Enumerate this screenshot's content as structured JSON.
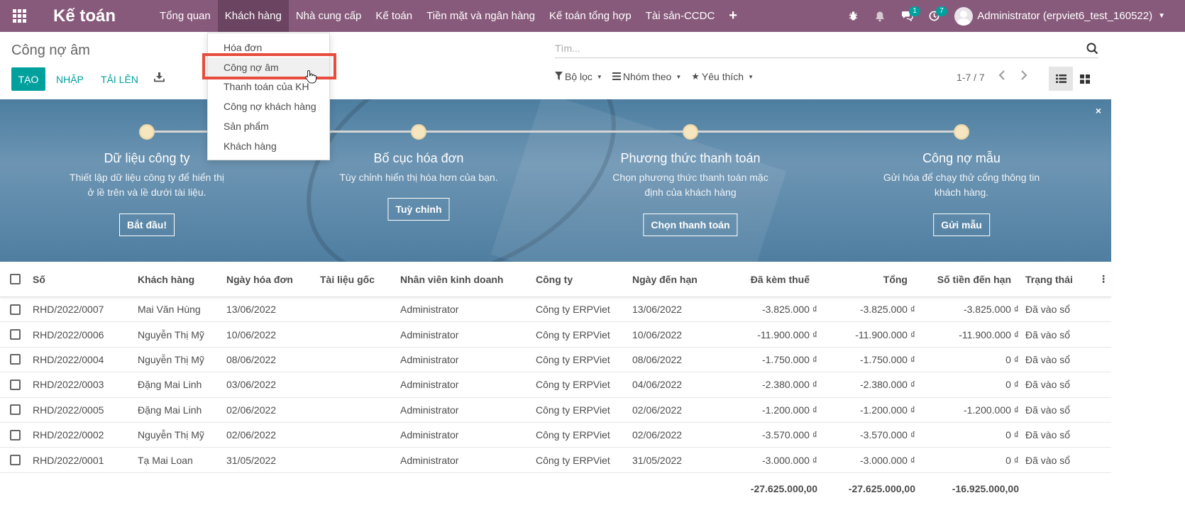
{
  "navbar": {
    "brand": "Kế toán",
    "menu": [
      "Tổng quan",
      "Khách hàng",
      "Nhà cung cấp",
      "Kế toán",
      "Tiền mặt và ngân hàng",
      "Kế toán tổng hợp",
      "Tài sản-CCDC"
    ],
    "active_menu": "Khách hàng",
    "plus": "+",
    "messages_count": "1",
    "activities_count": "7",
    "user": "Administrator (erpviet6_test_160522)"
  },
  "control": {
    "breadcrumb": "Công nợ âm",
    "search_placeholder": "Tìm...",
    "create_label": "TẠO",
    "import_label": "NHẬP",
    "upload_label": "TẢI LÊN",
    "filter_label": "Bộ lọc",
    "groupby_label": "Nhóm theo",
    "favorites_label": "Yêu thích",
    "pager": "1-7 / 7"
  },
  "dropdown": {
    "items": [
      "Hóa đơn",
      "Công nợ âm",
      "Thanh toán của KH",
      "Công nợ khách hàng",
      "Sản phẩm",
      "Khách hàng"
    ],
    "highlighted": "Công nợ âm"
  },
  "banner": {
    "close": "×",
    "steps": [
      {
        "title": "Dữ liệu công ty",
        "desc1": "Thiết lập dữ liệu công ty để hiển thị",
        "desc2": "ở lề trên và lề dưới tài liệu.",
        "button": "Bắt đầu!"
      },
      {
        "title": "Bố cục hóa đơn",
        "desc1": "Tùy chỉnh hiển thị hóa hơn của bạn.",
        "desc2": "",
        "button": "Tuỳ chỉnh"
      },
      {
        "title": "Phương thức thanh toán",
        "desc1": "Chọn phương thức thanh toán mặc",
        "desc2": "định của khách hàng",
        "button": "Chọn thanh toán"
      },
      {
        "title": "Công nợ mẫu",
        "desc1": "Gửi hóa để chạy thử cổng thông tin",
        "desc2": "khách hàng.",
        "button": "Gửi mẫu"
      }
    ]
  },
  "table": {
    "headers": [
      "Số",
      "Khách hàng",
      "Ngày hóa đơn",
      "Tài liệu gốc",
      "Nhân viên kinh doanh",
      "Công ty",
      "Ngày đến hạn",
      "Đã kèm thuế",
      "Tổng",
      "Số tiền đến hạn",
      "Trạng thái"
    ],
    "rows": [
      [
        "RHD/2022/0007",
        "Mai Văn Hùng",
        "13/06/2022",
        "",
        "Administrator",
        "Công ty ERPViet",
        "13/06/2022",
        "-3.825.000 ₫",
        "-3.825.000 ₫",
        "-3.825.000 ₫",
        "Đã vào sổ"
      ],
      [
        "RHD/2022/0006",
        "Nguyễn Thị Mỹ",
        "10/06/2022",
        "",
        "Administrator",
        "Công ty ERPViet",
        "10/06/2022",
        "-11.900.000 ₫",
        "-11.900.000 ₫",
        "-11.900.000 ₫",
        "Đã vào sổ"
      ],
      [
        "RHD/2022/0004",
        "Nguyễn Thị Mỹ",
        "08/06/2022",
        "",
        "Administrator",
        "Công ty ERPViet",
        "08/06/2022",
        "-1.750.000 ₫",
        "-1.750.000 ₫",
        "0 ₫",
        "Đã vào sổ"
      ],
      [
        "RHD/2022/0003",
        "Đặng Mai Linh",
        "03/06/2022",
        "",
        "Administrator",
        "Công ty ERPViet",
        "04/06/2022",
        "-2.380.000 ₫",
        "-2.380.000 ₫",
        "0 ₫",
        "Đã vào sổ"
      ],
      [
        "RHD/2022/0005",
        "Đặng Mai Linh",
        "02/06/2022",
        "",
        "Administrator",
        "Công ty ERPViet",
        "02/06/2022",
        "-1.200.000 ₫",
        "-1.200.000 ₫",
        "-1.200.000 ₫",
        "Đã vào sổ"
      ],
      [
        "RHD/2022/0002",
        "Nguyễn Thị Mỹ",
        "02/06/2022",
        "",
        "Administrator",
        "Công ty ERPViet",
        "02/06/2022",
        "-3.570.000 ₫",
        "-3.570.000 ₫",
        "0 ₫",
        "Đã vào sổ"
      ],
      [
        "RHD/2022/0001",
        "Tạ Mai Loan",
        "31/05/2022",
        "",
        "Administrator",
        "Công ty ERPViet",
        "31/05/2022",
        "-3.000.000 ₫",
        "-3.000.000 ₫",
        "0 ₫",
        "Đã vào sổ"
      ]
    ],
    "totals": {
      "tax_included": "-27.625.000,00",
      "total": "-27.625.000,00",
      "amount_due": "-16.925.000,00"
    }
  },
  "colors": {
    "brand": "#875a7b",
    "accent": "#00a09d",
    "highlight": "#e74c3c"
  }
}
